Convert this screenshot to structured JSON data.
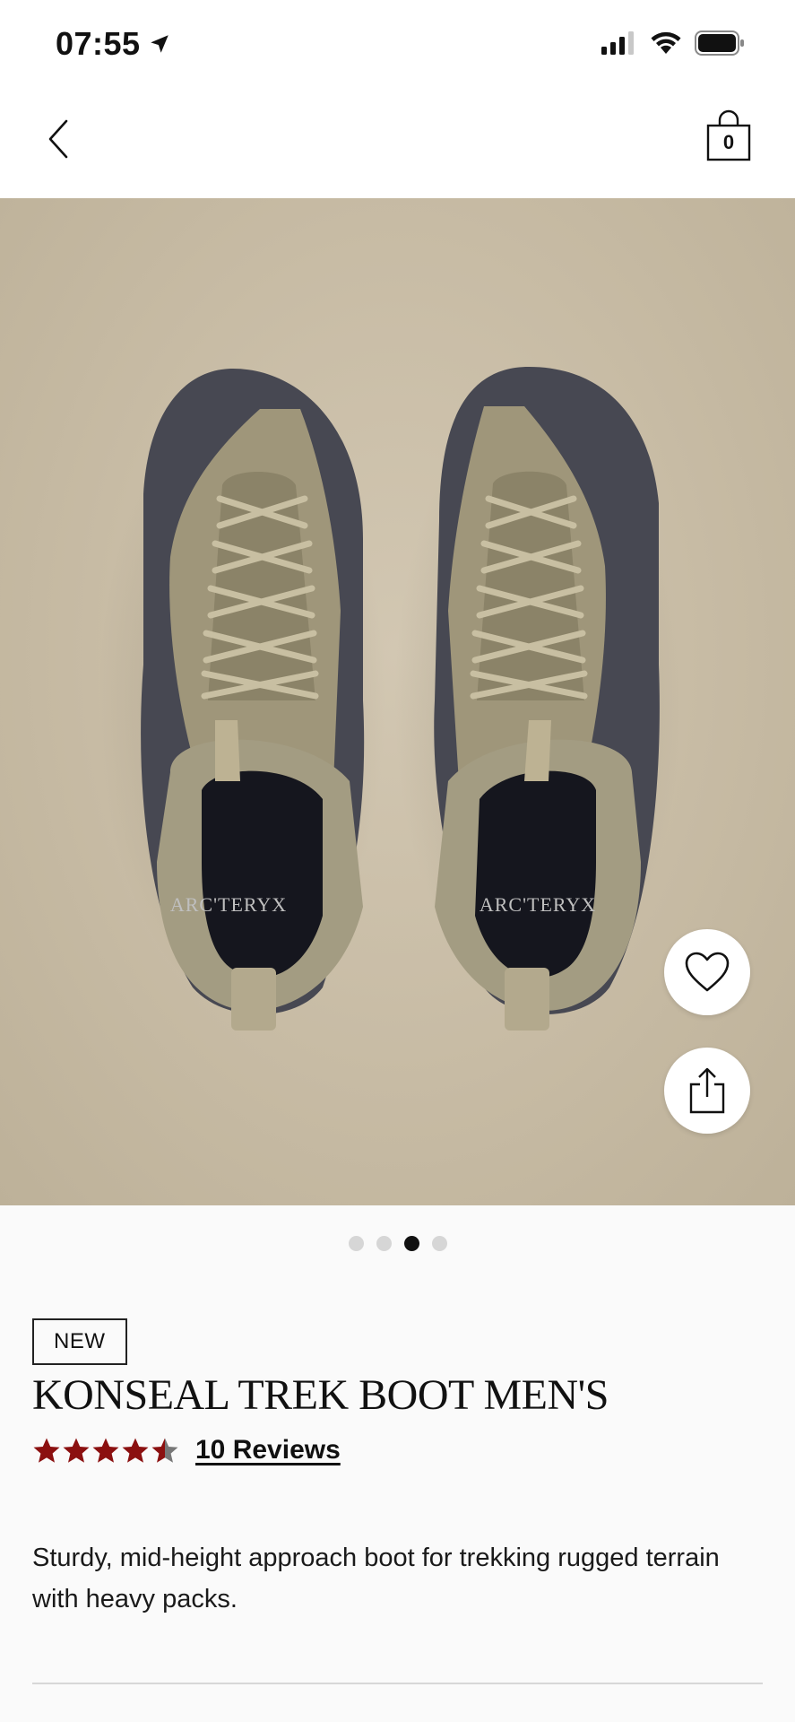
{
  "status_bar": {
    "time": "07:55"
  },
  "nav": {
    "bag_count": "0"
  },
  "hero": {
    "logo_text": "ARC'TERYX"
  },
  "carousel": {
    "dot_count": 4,
    "active_index": 2
  },
  "product": {
    "badge": "NEW",
    "title": "KONSEAL TREK BOOT MEN'S",
    "rating": 4.5,
    "reviews_label": "10 Reviews",
    "description": "Sturdy, mid-height approach boot for trekking rugged terrain with heavy packs."
  },
  "colors": {
    "star": "#8b1010",
    "accent": "#111111"
  }
}
